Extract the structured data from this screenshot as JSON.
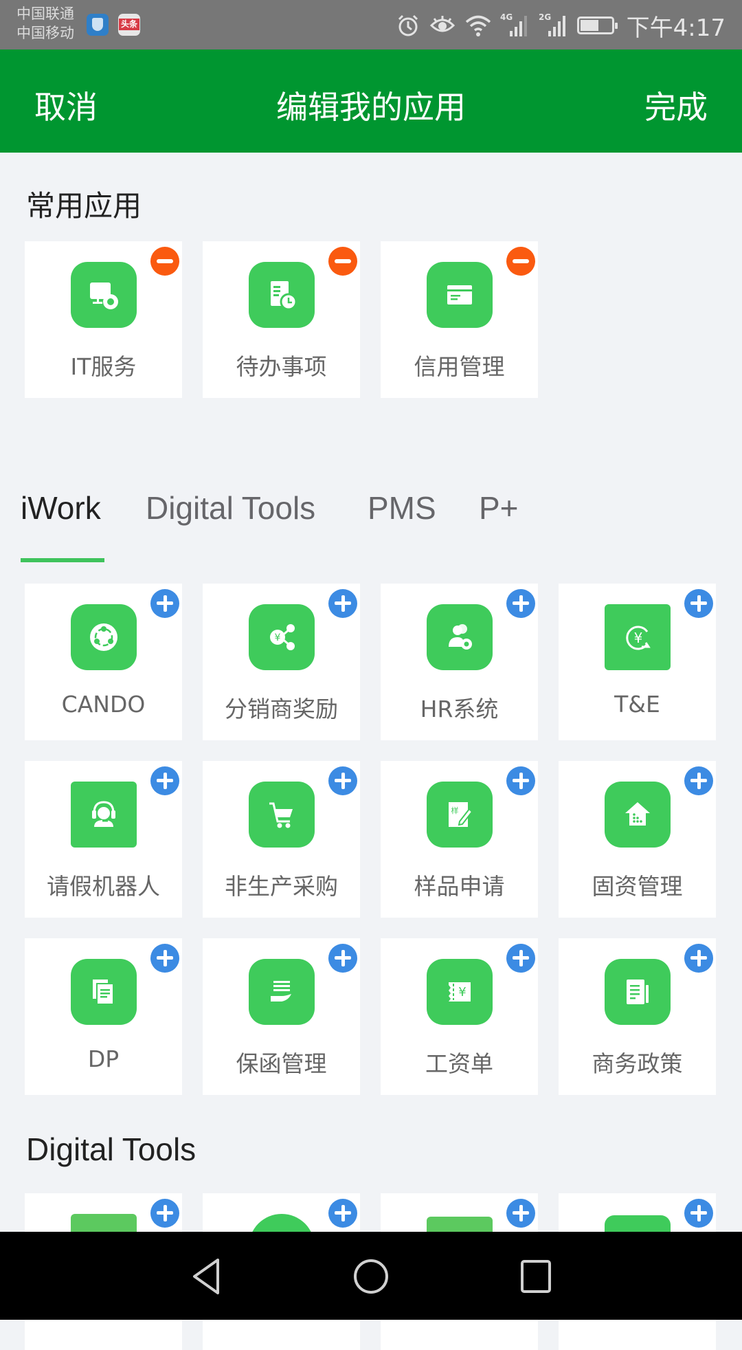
{
  "status_bar": {
    "carrier_1": "中国联通",
    "carrier_2": "中国移动",
    "notification_apps": [
      "shield-security-app",
      "toutiao-app"
    ],
    "toutiao_label": "头条",
    "network_1": "4G",
    "network_2": "2G",
    "time": "下午4:17"
  },
  "header": {
    "cancel_label": "取消",
    "title": "编辑我的应用",
    "done_label": "完成",
    "bg_color": "#009630"
  },
  "favorites": {
    "title": "常用应用",
    "items": [
      {
        "label": "IT服务",
        "icon": "monitor-gear-icon",
        "action": "remove"
      },
      {
        "label": "待办事项",
        "icon": "document-clock-icon",
        "action": "remove"
      },
      {
        "label": "信用管理",
        "icon": "credit-card-icon",
        "action": "remove"
      }
    ]
  },
  "tabs": {
    "items": [
      {
        "label": "iWork",
        "active": true
      },
      {
        "label": "Digital Tools",
        "active": false
      },
      {
        "label": "PMS",
        "active": false
      },
      {
        "label": "P+",
        "active": false
      }
    ]
  },
  "iwork": {
    "items": [
      {
        "label": "CANDO",
        "icon": "circle-nodes-icon",
        "action": "add"
      },
      {
        "label": "分销商奖励",
        "icon": "yuan-share-icon",
        "action": "add"
      },
      {
        "label": "HR系统",
        "icon": "user-gear-icon",
        "action": "add"
      },
      {
        "label": "T&E",
        "icon": "yuan-refresh-icon",
        "action": "add"
      },
      {
        "label": "请假机器人",
        "icon": "headset-agent-icon",
        "action": "add"
      },
      {
        "label": "非生产采购",
        "icon": "shopping-cart-icon",
        "action": "add"
      },
      {
        "label": "样品申请",
        "icon": "sample-pencil-icon",
        "action": "add"
      },
      {
        "label": "固资管理",
        "icon": "building-house-icon",
        "action": "add"
      },
      {
        "label": "DP",
        "icon": "documents-icon",
        "action": "add"
      },
      {
        "label": "保函管理",
        "icon": "hand-document-icon",
        "action": "add"
      },
      {
        "label": "工资单",
        "icon": "yuan-ticket-icon",
        "action": "add"
      },
      {
        "label": "商务政策",
        "icon": "newspaper-icon",
        "action": "add"
      }
    ]
  },
  "digital_tools": {
    "title": "Digital Tools",
    "items": [
      {
        "icon": "app-icon-1",
        "action": "add"
      },
      {
        "icon": "app-icon-2",
        "action": "add"
      },
      {
        "icon": "app-icon-3",
        "action": "add"
      },
      {
        "icon": "app-icon-4",
        "action": "add"
      }
    ]
  },
  "colors": {
    "app_green": "#3fcb5b",
    "remove_badge": "#fa5a10",
    "add_badge": "#3c8be3",
    "tab_indicator": "#3fc35c"
  }
}
